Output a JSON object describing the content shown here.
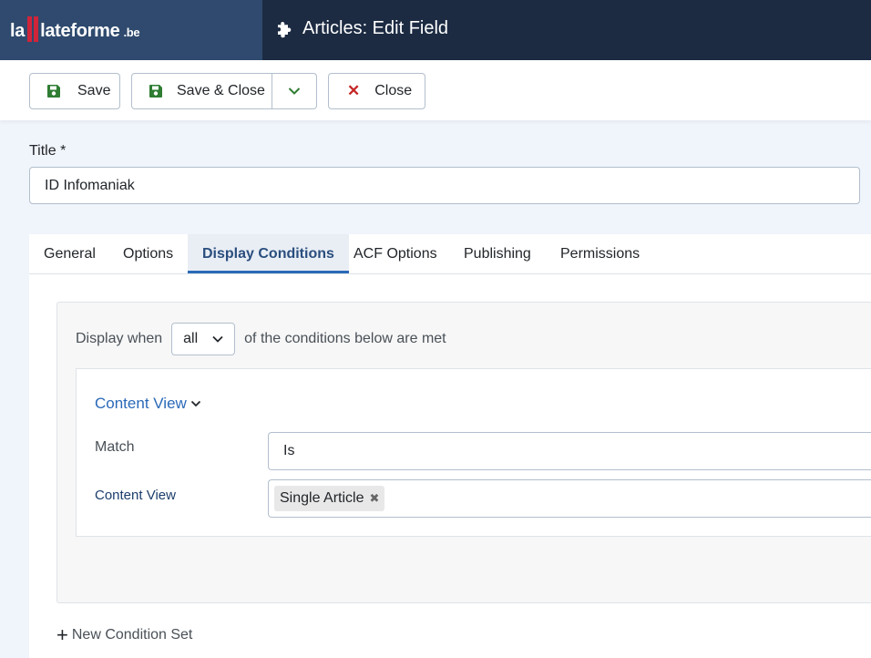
{
  "brand": {
    "prefix": "la",
    "name": "lateforme",
    "suffix": ".be",
    "accent": "#d0243a"
  },
  "header": {
    "title": "Articles: Edit Field",
    "icon": "puzzle-icon"
  },
  "toolbar": {
    "save_label": "Save",
    "save_close_label": "Save & Close",
    "close_label": "Close"
  },
  "form": {
    "title_label": "Title *",
    "title_value": "ID Infomaniak"
  },
  "tabs": [
    {
      "label": "General"
    },
    {
      "label": "Options"
    },
    {
      "label": "Display Conditions",
      "active": true
    },
    {
      "label": "ACF Options"
    },
    {
      "label": "Publishing"
    },
    {
      "label": "Permissions"
    }
  ],
  "conditions": {
    "display_when_label": "Display when",
    "mode_value": "all",
    "suffix_text": "of the conditions below are met",
    "condition_title": "Content View",
    "match_label": "Match",
    "match_value": "Is",
    "content_view_label": "Content View",
    "selected_tags": [
      "Single Article"
    ],
    "new_condition_set_label": "New Condition Set"
  }
}
